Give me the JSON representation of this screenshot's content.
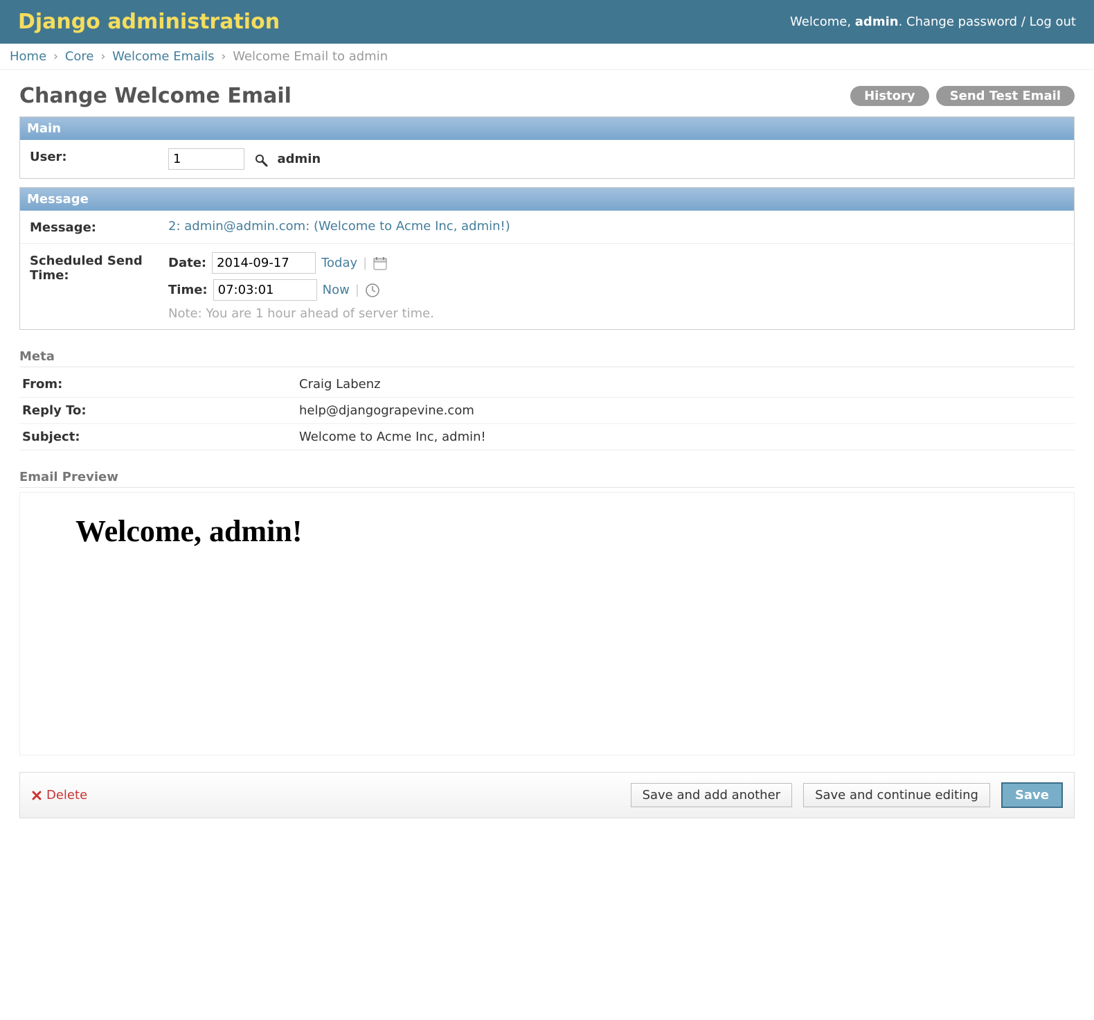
{
  "header": {
    "branding": "Django administration",
    "welcome_prefix": "Welcome, ",
    "username": "admin",
    "change_password": "Change password",
    "logout": "Log out"
  },
  "breadcrumbs": {
    "home": "Home",
    "app": "Core",
    "model": "Welcome Emails",
    "object": "Welcome Email to admin"
  },
  "page": {
    "title": "Change Welcome Email",
    "history": "History",
    "send_test": "Send Test Email"
  },
  "fieldsets": {
    "main": {
      "legend": "Main",
      "user_label": "User:",
      "user_value": "1",
      "user_display": "admin"
    },
    "message": {
      "legend": "Message",
      "message_label": "Message:",
      "message_link": "2: admin@admin.com: (Welcome to Acme Inc, admin!)",
      "schedule_label": "Scheduled Send Time:",
      "date_label": "Date:",
      "date_value": "2014-09-17",
      "today": "Today",
      "time_label": "Time:",
      "time_value": "07:03:01",
      "now": "Now",
      "note": "Note: You are 1 hour ahead of server time."
    }
  },
  "meta": {
    "heading": "Meta",
    "from_label": "From:",
    "from_value": "Craig Labenz",
    "reply_to_label": "Reply To:",
    "reply_to_value": "help@djangograpevine.com",
    "subject_label": "Subject:",
    "subject_value": "Welcome to Acme Inc, admin!"
  },
  "preview": {
    "heading": "Email Preview",
    "body_heading": "Welcome, admin!"
  },
  "submit": {
    "delete": "Delete",
    "save_add": "Save and add another",
    "save_continue": "Save and continue editing",
    "save": "Save"
  }
}
